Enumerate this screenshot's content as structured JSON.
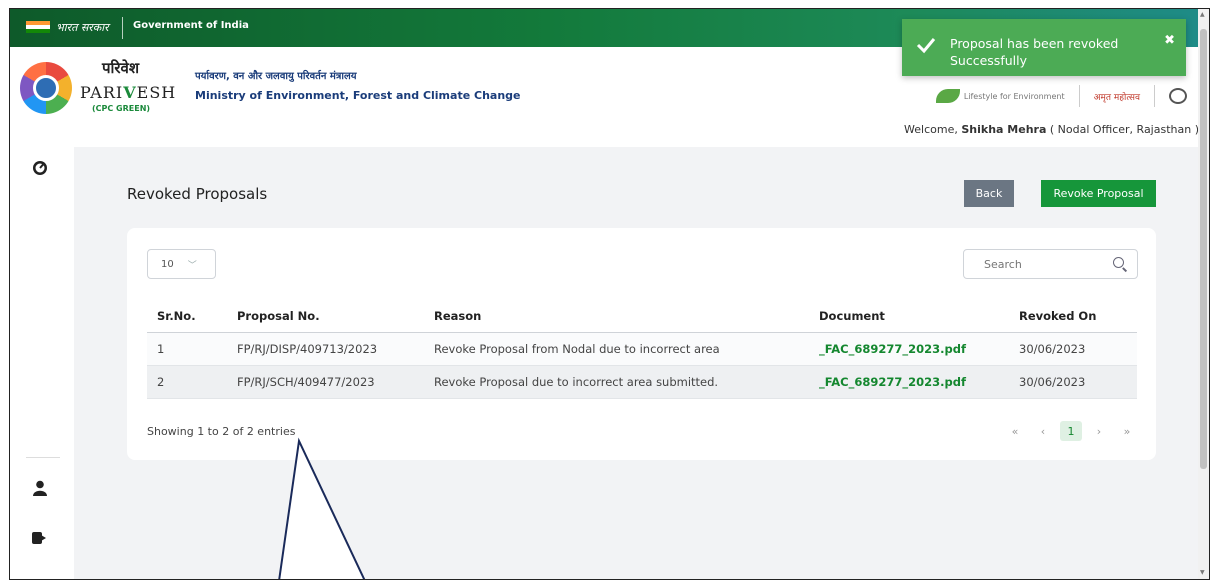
{
  "gov_bar": {
    "hindi": "भारत सरकार",
    "english": "Government of India"
  },
  "header": {
    "brand_hindi": "परिवेश",
    "brand_english_1": "PARI",
    "brand_english_v": "V",
    "brand_english_2": "ESH",
    "brand_sub": "(CPC GREEN)",
    "ministry_hindi": "पर्यावरण, वन और जलवायु परिवर्तन मंत्रालय",
    "ministry_english": "Ministry of Environment, Forest and Climate Change",
    "partner_lifestyle": "Lifestyle for Environment",
    "partner_amrit": "अमृत महोत्सव",
    "welcome_prefix": "Welcome,",
    "user_name": "Shikha Mehra",
    "user_role": "( Nodal Officer, Rajasthan )"
  },
  "sidebar": {
    "icons": [
      "dashboard-icon",
      "user-icon",
      "logout-icon"
    ]
  },
  "page": {
    "title": "Revoked Proposals",
    "back_label": "Back",
    "revoke_label": "Revoke Proposal"
  },
  "table_controls": {
    "page_size": "10",
    "search_placeholder": "Search"
  },
  "table": {
    "headers": [
      "Sr.No.",
      "Proposal No.",
      "Reason",
      "Document",
      "Revoked On"
    ],
    "rows": [
      [
        "1",
        "FP/RJ/DISP/409713/2023",
        "Revoke Proposal from Nodal due to incorrect area",
        "_FAC_689277_2023.pdf",
        "30/06/2023"
      ],
      [
        "2",
        "FP/RJ/SCH/409477/2023",
        "Revoke Proposal due to incorrect area submitted.",
        "_FAC_689277_2023.pdf",
        "30/06/2023"
      ]
    ]
  },
  "footer": {
    "showing": "Showing 1 to 2 of 2 entries",
    "current_page": "1"
  },
  "toast": {
    "message": "Proposal has been revoked Successfully",
    "close": "✖"
  },
  "colors": {
    "primary_green": "#16963a",
    "back_grey": "#6b7683",
    "toast_green": "#4cab55"
  }
}
